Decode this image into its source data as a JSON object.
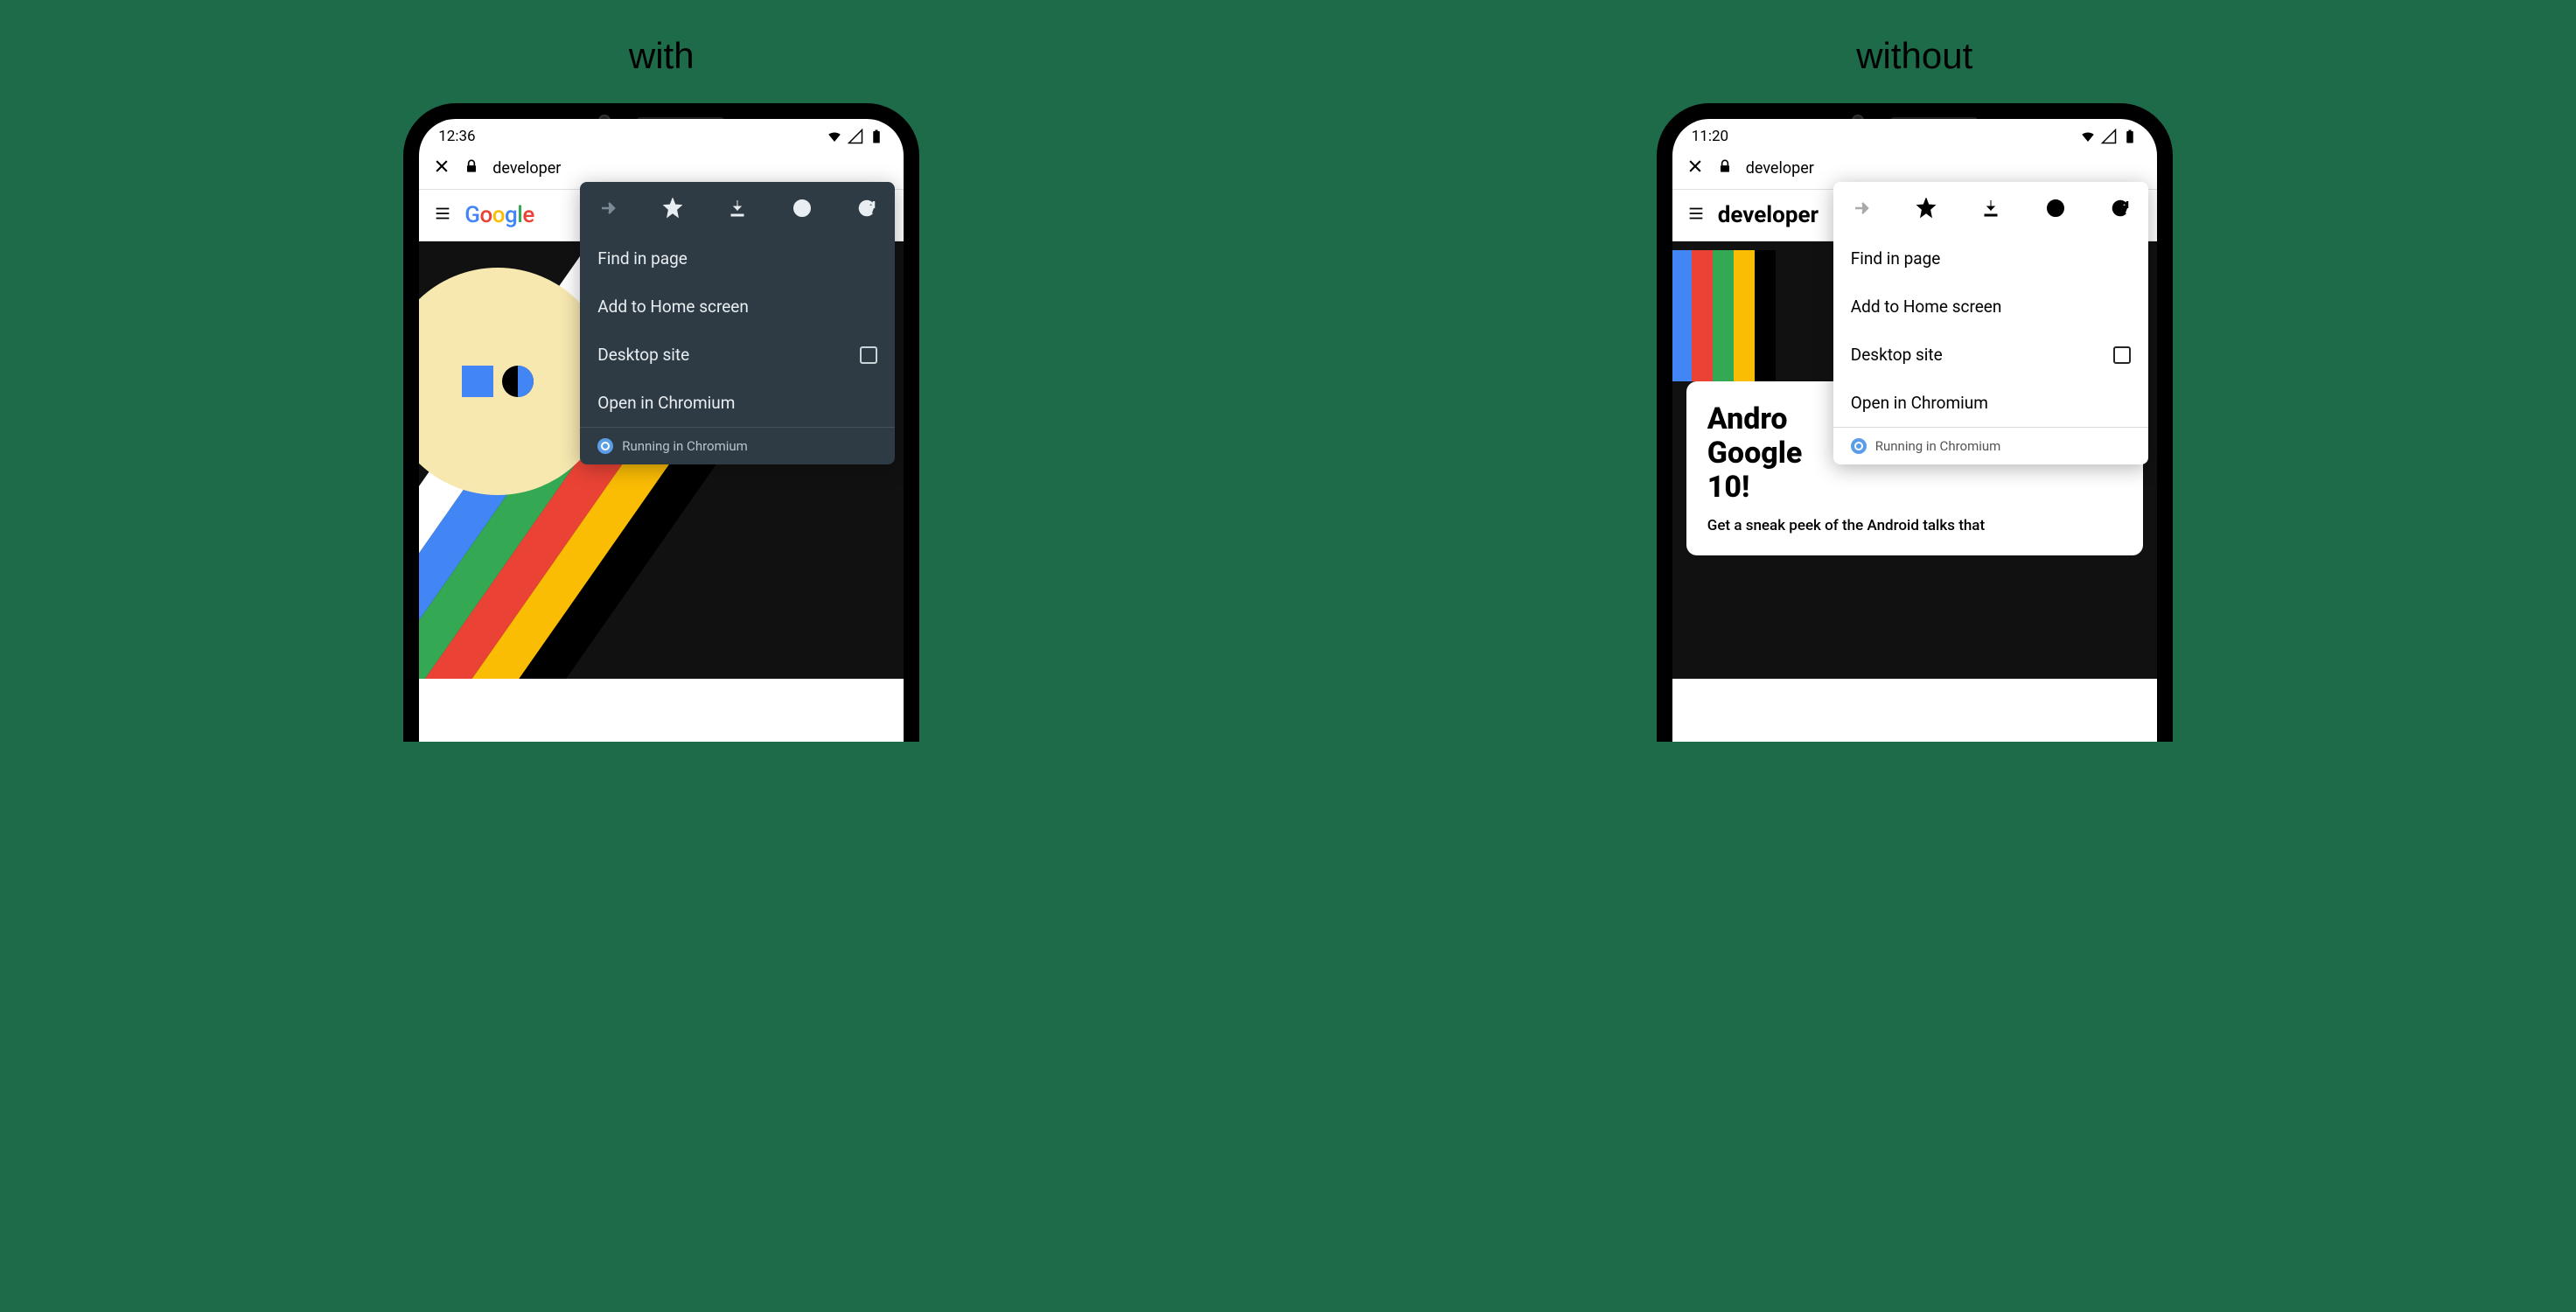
{
  "labels": {
    "with": "with",
    "without": "without"
  },
  "left": {
    "time": "12:36",
    "url": "developer",
    "app_title": "Google"
  },
  "right": {
    "time": "11:20",
    "url": "developer",
    "app_title": "developer",
    "card_title_1": "Andro",
    "card_title_2": "Google",
    "card_title_3": "10!",
    "card_sub": "Get a sneak peek of the Android talks that"
  },
  "menu": {
    "find": "Find in page",
    "add": "Add to Home screen",
    "desktop": "Desktop site",
    "open": "Open in Chromium",
    "running": "Running in Chromium"
  }
}
